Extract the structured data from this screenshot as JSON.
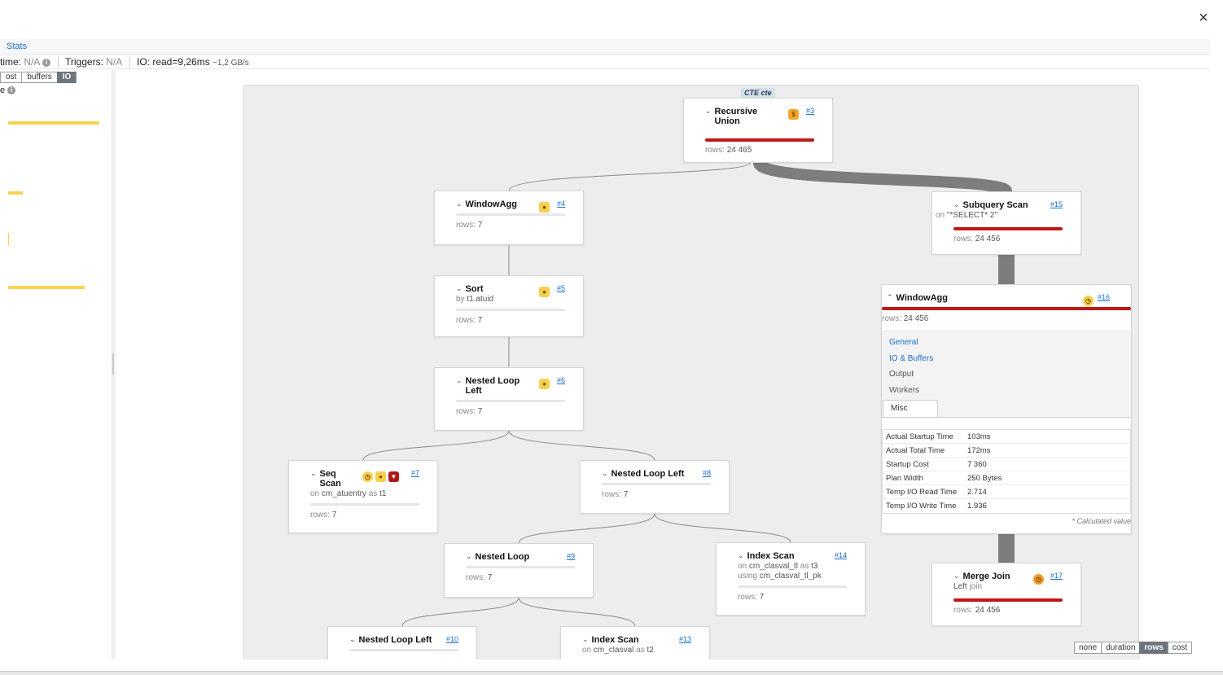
{
  "dialog": {
    "close_glyph": "×"
  },
  "stats_tab": {
    "label": "Stats"
  },
  "summary": {
    "time_label": "time:",
    "time_value": "N/A",
    "triggers_label": "Triggers:",
    "triggers_value": "N/A",
    "io_label": "IO: read=9,26ms",
    "io_rate": "~1,2 GB/s"
  },
  "sidebar": {
    "metric_toggle": [
      {
        "label": "ost",
        "active": false
      },
      {
        "label": "buffers",
        "active": false
      },
      {
        "label": "IO",
        "active": true
      }
    ],
    "section_label": "e",
    "bars": [
      {
        "level": 0.92
      },
      {
        "level": 0.15
      },
      {
        "level": 0.02
      },
      {
        "level": 0.77
      }
    ]
  },
  "cte": {
    "label": "CTE cte"
  },
  "nodes": {
    "n3": {
      "title": "Recursive Union",
      "id": "#3",
      "rows_label": "rows:",
      "rows": "24 465",
      "badge_cost": "$"
    },
    "n4": {
      "title": "WindowAgg",
      "id": "#4",
      "rows_label": "rows:",
      "rows": "7"
    },
    "n5": {
      "title": "Sort",
      "id": "#5",
      "sub_k": "by",
      "sub_v": "t1.atuid",
      "rows_label": "rows:",
      "rows": "7"
    },
    "n6": {
      "title": "Nested Loop Left",
      "id": "#6",
      "rows_label": "rows:",
      "rows": "7"
    },
    "n7": {
      "title": "Seq Scan",
      "id": "#7",
      "sub_k": "on",
      "sub_v": "cm_atuentry",
      "sub_k2": "as",
      "sub_v2": "t1",
      "rows_label": "rows:",
      "rows": "7"
    },
    "n8": {
      "title": "Nested Loop Left",
      "id": "#8",
      "rows_label": "rows:",
      "rows": "7"
    },
    "n9": {
      "title": "Nested Loop",
      "id": "#9",
      "rows_label": "rows:",
      "rows": "7"
    },
    "n10": {
      "title": "Nested Loop Left",
      "id": "#10"
    },
    "n13": {
      "title": "Index Scan",
      "id": "#13",
      "sub_k": "on",
      "sub_v": "cm_clasval",
      "sub_k2": "as",
      "sub_v2": "t2"
    },
    "n14": {
      "title": "Index Scan",
      "id": "#14",
      "sub_k": "on",
      "sub_v": "cm_clasval_tl",
      "sub_k2": "as",
      "sub_v2": "t3",
      "sub2_k": "using",
      "sub2_v": "cm_clasval_tl_pk",
      "rows_label": "rows:",
      "rows": "7"
    },
    "n15": {
      "title": "Subquery Scan",
      "id": "#15",
      "sub_k": "on",
      "sub_v": "\"*SELECT* 2\"",
      "rows_label": "rows:",
      "rows": "24 456"
    },
    "n16": {
      "title": "WindowAgg",
      "id": "#16",
      "rows_label": "rows:",
      "rows": "24 456",
      "tabs": [
        "General",
        "IO & Buffers",
        "Output",
        "Workers",
        "Misc"
      ],
      "misc": [
        {
          "k": "Actual Startup Time",
          "v": "103ms"
        },
        {
          "k": "Actual Total Time",
          "v": "172ms"
        },
        {
          "k": "Startup Cost",
          "v": "7 360"
        },
        {
          "k": "Plan Width",
          "v": "250 Bytes"
        },
        {
          "k": "Temp I/O Read Time",
          "v": "2.714"
        },
        {
          "k": "Temp I/O Write Time",
          "v": "1.936"
        }
      ],
      "calc_note": "* Calculated value"
    },
    "n17": {
      "title": "Merge Join",
      "id": "#17",
      "sub_v": "Left",
      "sub_k": "join",
      "rows_label": "rows:",
      "rows": "24 456"
    }
  },
  "color_toggle": [
    {
      "label": "none",
      "active": false
    },
    {
      "label": "duration",
      "active": false
    },
    {
      "label": "rows",
      "active": true
    },
    {
      "label": "cost",
      "active": false
    }
  ],
  "colors": {
    "accent": "#1a6fd0",
    "bar_red": "#c01818",
    "edge_gray": "#8a8a8a",
    "sidebar_bar": "#f7d44c"
  }
}
